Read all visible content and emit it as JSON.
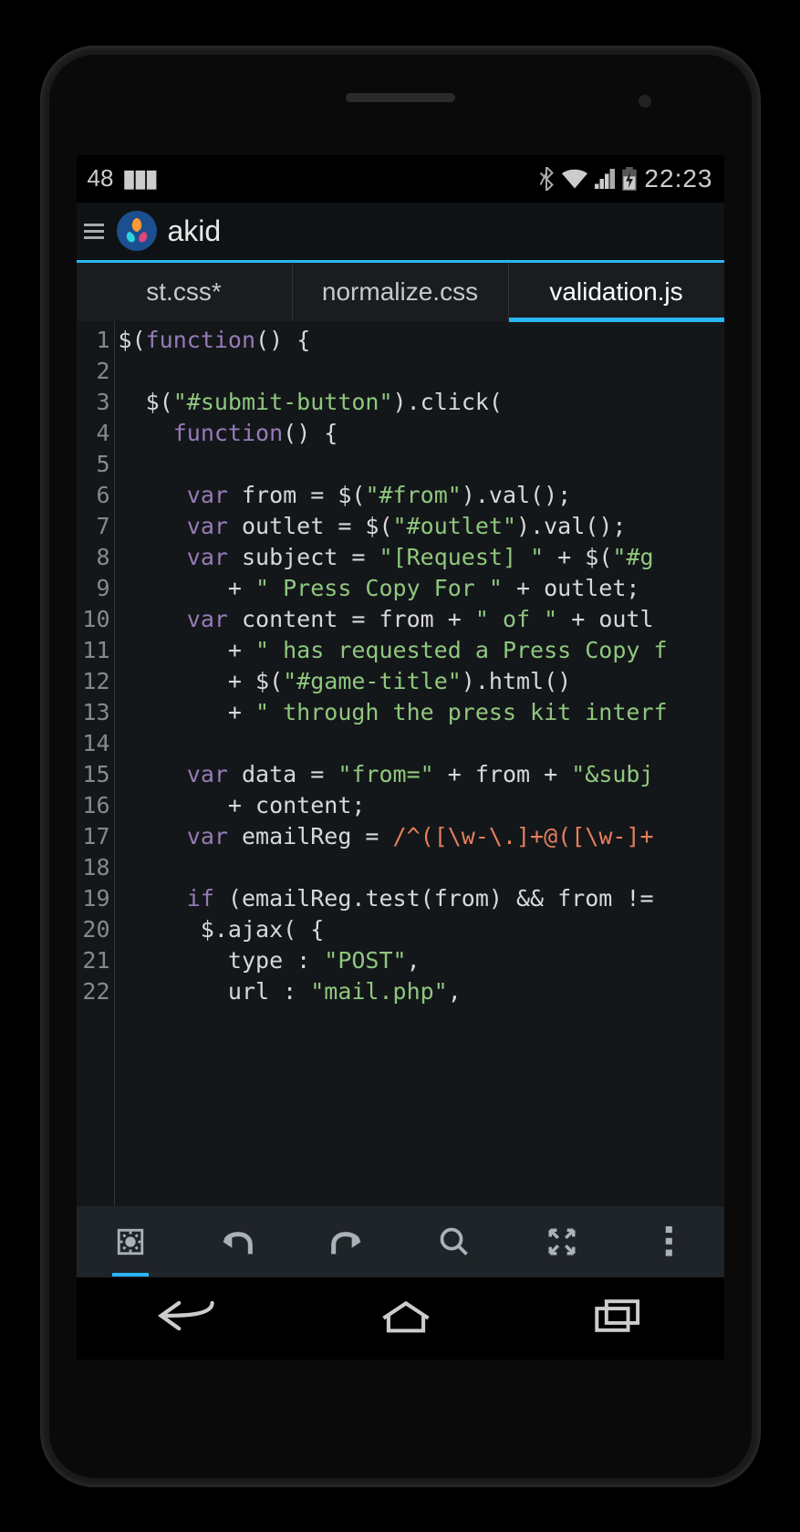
{
  "status": {
    "count": "48",
    "time": "22:23"
  },
  "header": {
    "title": "akid"
  },
  "tabs": [
    {
      "label": "st.css*",
      "active": false
    },
    {
      "label": "normalize.css",
      "active": false
    },
    {
      "label": "validation.js",
      "active": true
    }
  ],
  "code": {
    "lines": [
      {
        "n": "1",
        "tokens": [
          [
            "fn",
            "$"
          ],
          [
            "par",
            "("
          ],
          [
            "kw",
            "function"
          ],
          [
            "par",
            "()"
          ],
          [
            "op",
            " {"
          ]
        ]
      },
      {
        "n": "2",
        "tokens": []
      },
      {
        "n": "3",
        "tokens": [
          [
            "id",
            "  $"
          ],
          [
            "par",
            "("
          ],
          [
            "str",
            "\"#submit-button\""
          ],
          [
            "par",
            ")"
          ],
          [
            "op",
            ".click("
          ]
        ]
      },
      {
        "n": "4",
        "tokens": [
          [
            "id",
            "    "
          ],
          [
            "kw",
            "function"
          ],
          [
            "par",
            "()"
          ],
          [
            "op",
            " {"
          ]
        ]
      },
      {
        "n": "5",
        "tokens": []
      },
      {
        "n": "6",
        "tokens": [
          [
            "id",
            "     "
          ],
          [
            "kw",
            "var"
          ],
          [
            "id",
            " from = $("
          ],
          [
            "str",
            "\"#from\""
          ],
          [
            "id",
            ").val();"
          ]
        ]
      },
      {
        "n": "7",
        "tokens": [
          [
            "id",
            "     "
          ],
          [
            "kw",
            "var"
          ],
          [
            "id",
            " outlet = $("
          ],
          [
            "str",
            "\"#outlet\""
          ],
          [
            "id",
            ").val();"
          ]
        ]
      },
      {
        "n": "8",
        "tokens": [
          [
            "id",
            "     "
          ],
          [
            "kw",
            "var"
          ],
          [
            "id",
            " subject = "
          ],
          [
            "str",
            "\"[Request] \""
          ],
          [
            "id",
            " + $("
          ],
          [
            "str",
            "\"#g"
          ]
        ]
      },
      {
        "n": "9",
        "tokens": [
          [
            "id",
            "        + "
          ],
          [
            "str",
            "\" Press Copy For \""
          ],
          [
            "id",
            " + outlet;"
          ]
        ]
      },
      {
        "n": "10",
        "tokens": [
          [
            "id",
            "     "
          ],
          [
            "kw",
            "var"
          ],
          [
            "id",
            " content = from + "
          ],
          [
            "str",
            "\" of \""
          ],
          [
            "id",
            " + outl"
          ]
        ]
      },
      {
        "n": "11",
        "tokens": [
          [
            "id",
            "        + "
          ],
          [
            "str",
            "\" has requested a Press Copy f"
          ]
        ]
      },
      {
        "n": "12",
        "tokens": [
          [
            "id",
            "        + $("
          ],
          [
            "str",
            "\"#game-title\""
          ],
          [
            "id",
            ").html()"
          ]
        ]
      },
      {
        "n": "13",
        "tokens": [
          [
            "id",
            "        + "
          ],
          [
            "str",
            "\" through the press kit interf"
          ]
        ]
      },
      {
        "n": "14",
        "tokens": []
      },
      {
        "n": "15",
        "tokens": [
          [
            "id",
            "     "
          ],
          [
            "kw",
            "var"
          ],
          [
            "id",
            " data = "
          ],
          [
            "str",
            "\"from=\""
          ],
          [
            "id",
            " + from + "
          ],
          [
            "str",
            "\"&subj"
          ]
        ]
      },
      {
        "n": "16",
        "tokens": [
          [
            "id",
            "        + content;"
          ]
        ]
      },
      {
        "n": "17",
        "tokens": [
          [
            "id",
            "     "
          ],
          [
            "kw",
            "var"
          ],
          [
            "id",
            " emailReg = "
          ],
          [
            "regex",
            "/^([\\w-\\.]+@([\\w-]+"
          ]
        ]
      },
      {
        "n": "18",
        "tokens": []
      },
      {
        "n": "19",
        "tokens": [
          [
            "id",
            "     "
          ],
          [
            "kw",
            "if"
          ],
          [
            "id",
            " (emailReg.test(from) && from !="
          ]
        ]
      },
      {
        "n": "20",
        "tokens": [
          [
            "id",
            "      $.ajax( {"
          ]
        ]
      },
      {
        "n": "21",
        "tokens": [
          [
            "id",
            "        type : "
          ],
          [
            "str",
            "\"POST\""
          ],
          [
            "id",
            ","
          ]
        ]
      },
      {
        "n": "22",
        "tokens": [
          [
            "id",
            "        url : "
          ],
          [
            "str",
            "\"mail.php\""
          ],
          [
            "id",
            ","
          ]
        ]
      }
    ]
  },
  "toolbar": {
    "buttons": [
      "settings",
      "undo",
      "redo",
      "search",
      "fullscreen",
      "more"
    ]
  },
  "nav": {
    "buttons": [
      "back",
      "home",
      "recent"
    ]
  }
}
